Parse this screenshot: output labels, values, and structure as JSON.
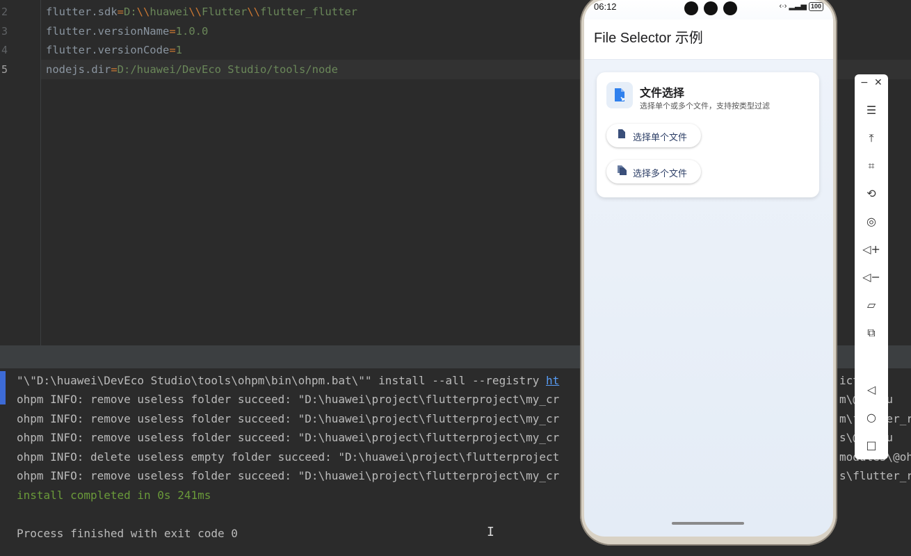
{
  "editor": {
    "lines": [
      {
        "num": "2",
        "key": "flutter.sdk",
        "value_parts": [
          "D:",
          "\\\\",
          "huawei",
          "\\\\",
          "Flutter",
          "\\\\",
          "flutter_flutter"
        ]
      },
      {
        "num": "3",
        "key": "flutter.versionName",
        "value": "1.0.0"
      },
      {
        "num": "4",
        "key": "flutter.versionCode",
        "value": "1"
      },
      {
        "num": "5",
        "key": "nodejs.dir",
        "value": "D:/huawei/DevEco Studio/tools/node"
      }
    ]
  },
  "console": {
    "lines": [
      {
        "text": "\"\\\"D:\\huawei\\DevEco Studio\\tools\\ohpm\\bin\\ohpm.bat\\\"\" install --all --registry ",
        "link": "ht",
        "tail": "ict tru"
      },
      {
        "text": "ohpm INFO: remove useless folder succeed: \"D:\\huawei\\project\\flutterproject\\my_cr",
        "tail": "m\\@c+flu"
      },
      {
        "text": "ohpm INFO: remove useless folder succeed: \"D:\\huawei\\project\\flutterproject\\my_cr",
        "tail": "m\\flutter_r"
      },
      {
        "text": "ohpm INFO: remove useless folder succeed: \"D:\\huawei\\project\\flutterproject\\my_cr",
        "tail": "s\\@c\\flu"
      },
      {
        "text": "ohpm INFO: delete useless empty folder succeed: \"D:\\huawei\\project\\flutterproject",
        "tail": "modules\\@oh"
      },
      {
        "text": "ohpm INFO: remove useless folder succeed: \"D:\\huawei\\project\\flutterproject\\my_cr",
        "tail": "s\\flutter_r"
      },
      {
        "text": "install completed in 0s 241ms"
      },
      {
        "text": ""
      },
      {
        "text": "Process finished with exit code 0"
      }
    ]
  },
  "phone": {
    "status_time": "06:12",
    "battery": "100",
    "app_title": "File Selector 示例",
    "card": {
      "title": "文件选择",
      "subtitle": "选择单个或多个文件，支持按类型过滤",
      "buttons": [
        {
          "label": "选择单个文件",
          "icon": "file-icon"
        },
        {
          "label": "选择多个文件",
          "icon": "files-icon"
        }
      ]
    }
  },
  "toolbar": {
    "items": [
      "menu-icon",
      "pin-top-icon",
      "crop-icon",
      "rotate-icon",
      "screenshot-icon",
      "volume-up-icon",
      "volume-down-icon",
      "shake-icon",
      "multi-device-icon",
      "back-icon",
      "home-icon",
      "recents-icon"
    ]
  }
}
